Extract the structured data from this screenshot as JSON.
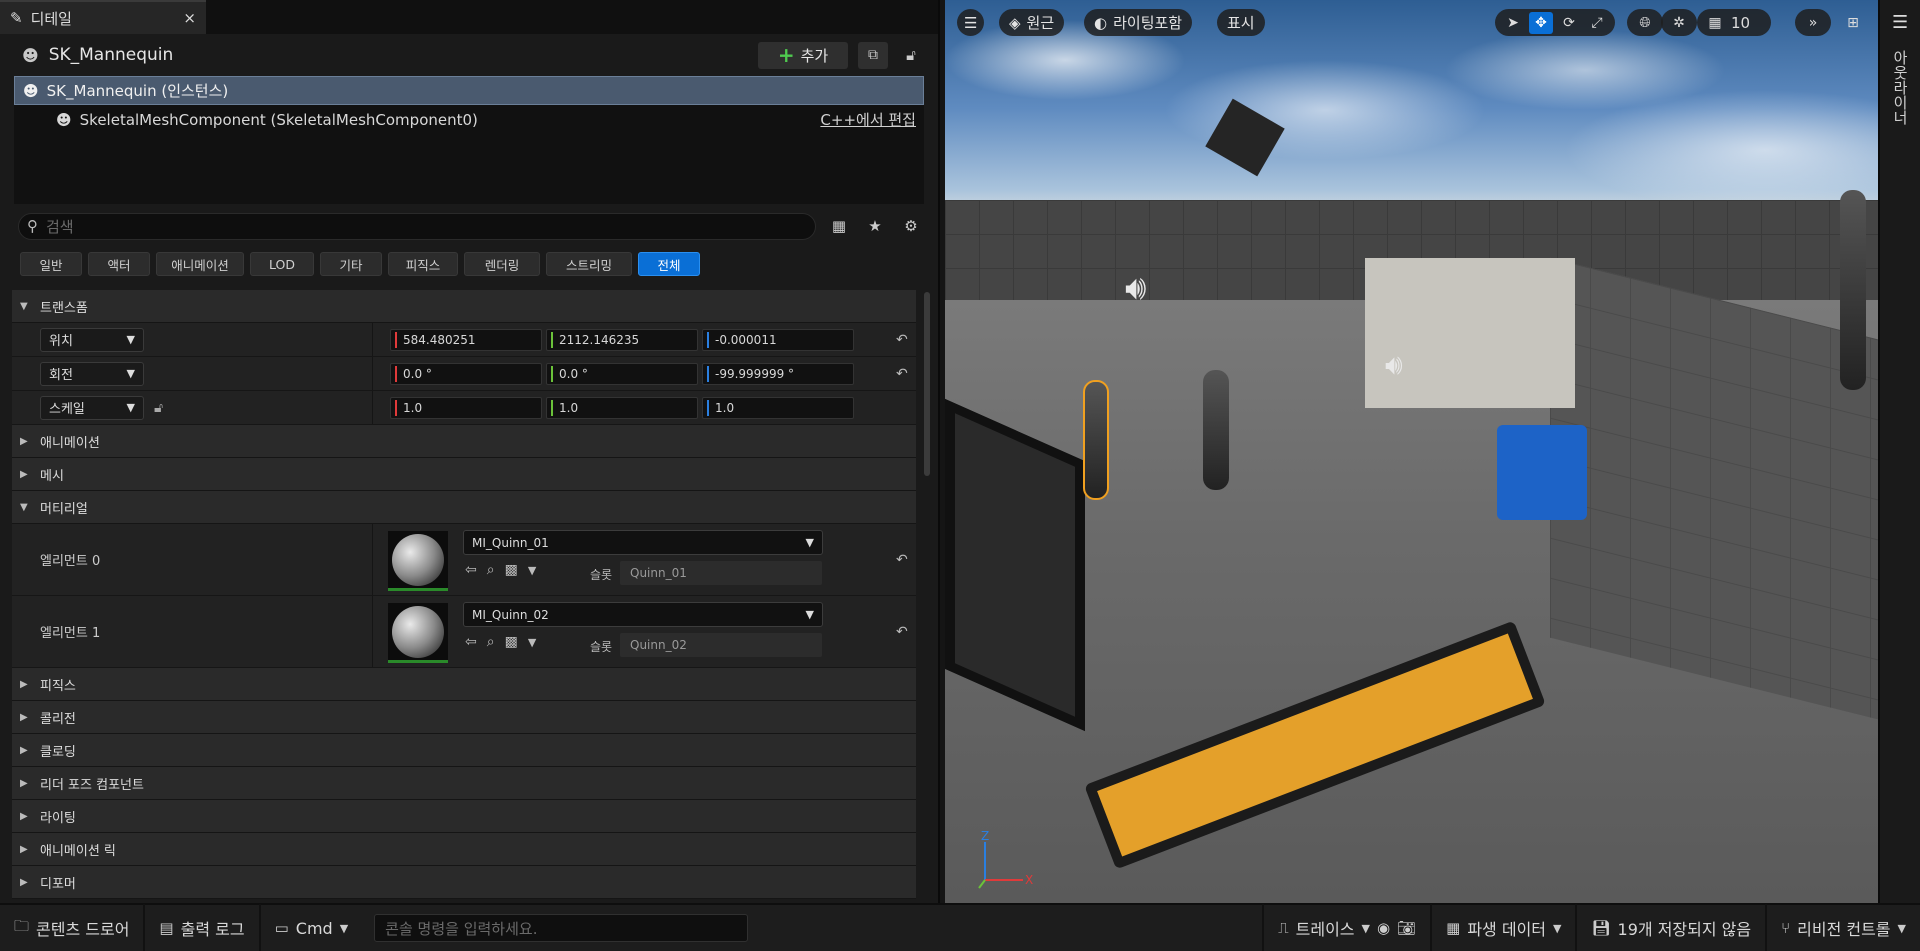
{
  "details": {
    "tab_title": "디테일",
    "tab_close": "×",
    "actor_name": "SK_Mannequin",
    "add_button": "추가",
    "tree": {
      "root": "SK_Mannequin (인스턴스)",
      "child": "SkeletalMeshComponent (SkeletalMeshComponent0)",
      "edit_cpp": "C++에서 편집"
    },
    "search_placeholder": "검색",
    "filters": [
      "일반",
      "액터",
      "애니메이션",
      "LOD",
      "기타",
      "피직스",
      "렌더링",
      "스트리밍",
      "전체"
    ],
    "active_filter": "전체",
    "categories": {
      "transform": "트랜스폼",
      "animation": "애니메이션",
      "mesh": "메시",
      "material": "머티리얼",
      "physics": "피직스",
      "collision": "콜리전",
      "clothing": "클로딩",
      "leader_pose": "리더 포즈 컴포넌트",
      "lighting": "라이팅",
      "anim_rig": "애니메이션 릭",
      "deformer": "디포머"
    },
    "transform": {
      "location": {
        "label": "위치",
        "x": "584.480251",
        "y": "2112.146235",
        "z": "-0.000011"
      },
      "rotation": {
        "label": "회전",
        "x": "0.0 °",
        "y": "0.0 °",
        "z": "-99.999999 °"
      },
      "scale": {
        "label": "스케일",
        "x": "1.0",
        "y": "1.0",
        "z": "1.0"
      }
    },
    "materials": [
      {
        "label": "엘리먼트 0",
        "material": "MI_Quinn_01",
        "slot_label": "슬롯",
        "slot": "Quinn_01"
      },
      {
        "label": "엘리먼트 1",
        "material": "MI_Quinn_02",
        "slot_label": "슬롯",
        "slot": "Quinn_02"
      }
    ]
  },
  "viewport": {
    "perspective": "원근",
    "lighting": "라이팅포함",
    "show": "표시",
    "grid_size": "10",
    "axis_z": "Z",
    "axis_x": "X"
  },
  "right_strip": {
    "label": "아웃라이너"
  },
  "statusbar": {
    "content_drawer": "콘텐츠 드로어",
    "output_log": "출력 로그",
    "cmd": "Cmd",
    "console_placeholder": "콘솔 명령을 입력하세요.",
    "trace": "트레이스",
    "derived_data": "파생 데이터",
    "unsaved": "19개 저장되지 않음",
    "revision_control": "리비전 컨트롤"
  },
  "colors": {
    "accent": "#0a6fd6",
    "x_axis": "#e03a3a",
    "y_axis": "#6bc23a",
    "z_axis": "#2a7fe0"
  }
}
